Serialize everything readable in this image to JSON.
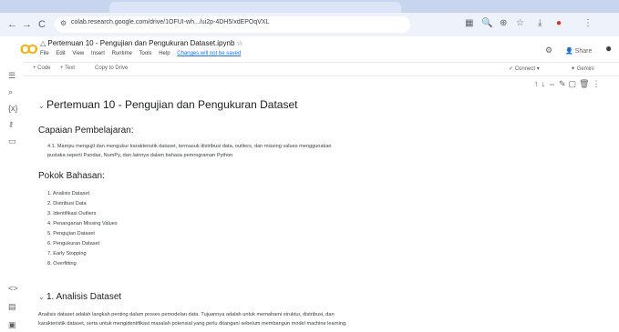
{
  "browser": {
    "url": "colab.research.google.com/drive/1OFUI-wh.../ui2p-4DH5/xdEPOqVXL",
    "back": "←",
    "forward": "→",
    "reload": "C"
  },
  "notebook": {
    "title": "Pertemuan 10 - Pengujian dan Pengukuran Dataset.ipynb",
    "menu": [
      "File",
      "Edit",
      "View",
      "Insert",
      "Runtime",
      "Tools",
      "Help"
    ],
    "save_status": "Changes will not be saved",
    "share_label": "Share",
    "toolbar": {
      "code": "+ Code",
      "text": "+ Text",
      "copy": "Copy to Drive",
      "connect": "Connect",
      "gemini": "Gemini"
    }
  },
  "content": {
    "heading": "Pertemuan 10 - Pengujian dan Pengukuran Dataset",
    "capaian_title": "Capaian Pembelajaran:",
    "capaian_line1": "4.1. Mampu mengujil dan mengukur karakteristik dataset, termasuk distribusi data, outliers, dan missing values menggunakan",
    "capaian_line2": "pustaka seperti Pandas, NumPy, dan lainnya dalam bahasa pemrograman Python",
    "pokok_title": "Pokok Bahasan:",
    "pokok_items": [
      "1. Analisis Dataset",
      "2. Distribusi Data",
      "3. Identifikasi Outliers",
      "4. Penanganan Missing Values",
      "5. Pengujian Dataset",
      "6. Pengukuran Dataset",
      "7. Early Stopping",
      "8. Overfitting"
    ],
    "section1_title": "1. Analisis Dataset",
    "section1_line1": "Analisis dataset adalah langkah penting dalam proses pemodelan data. Tujuannya adalah untuk memahami struktur, distribusi, dan",
    "section1_line2": "karakteristik dataset, serta untuk mengidentifikasi masalah potensial yang perlu ditangani sebelum membangun model machine learning."
  }
}
